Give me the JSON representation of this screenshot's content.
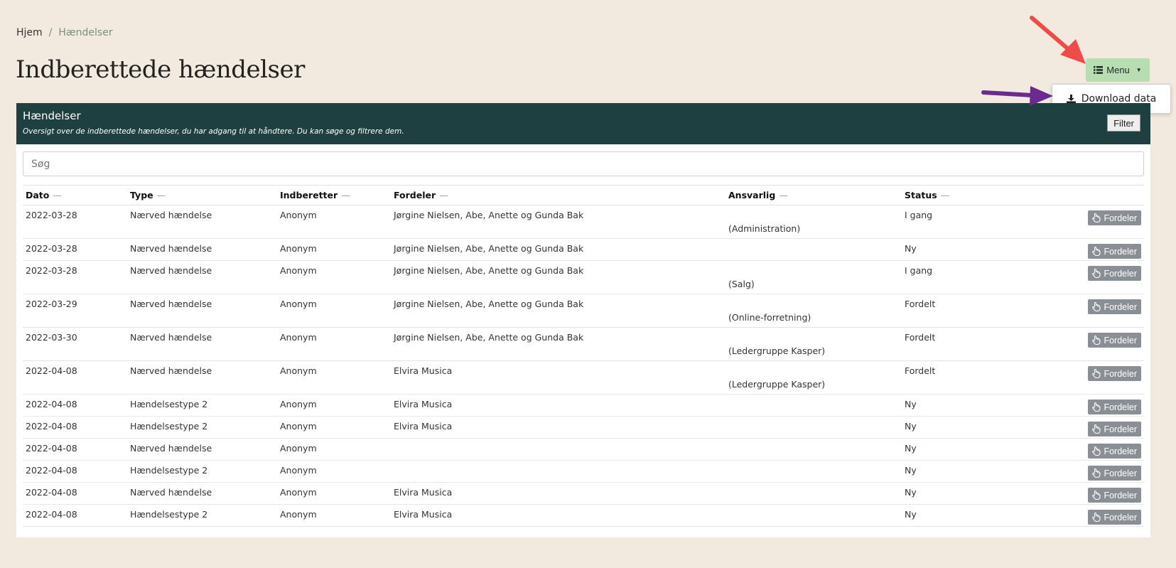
{
  "breadcrumb": {
    "home": "Hjem",
    "separator": "/",
    "current": "Hændelser"
  },
  "page_title": "Indberettede hændelser",
  "menu": {
    "label": "Menu",
    "icon": "list-icon",
    "dropdown_item": "Download data",
    "dropdown_icon": "download-icon"
  },
  "panel": {
    "title": "Hændelser",
    "description": "Oversigt over de indberettede hændelser, du har adgang til at håndtere. Du kan søge og filtrere dem.",
    "filter_label": "Filter"
  },
  "search": {
    "placeholder": "Søg"
  },
  "table": {
    "headers": [
      "Dato",
      "Type",
      "Indberetter",
      "Fordeler",
      "Ansvarlig",
      "Status"
    ],
    "sort_glyph": "—",
    "action_label": "Fordeler",
    "rows": [
      {
        "dato": "2022-03-28",
        "type": "Nærved hændelse",
        "indberetter": "Anonym",
        "fordeler": "Jørgine Nielsen, Abe, Anette og Gunda Bak",
        "ansvarlig": "(Administration)",
        "status": "I gang"
      },
      {
        "dato": "2022-03-28",
        "type": "Nærved hændelse",
        "indberetter": "Anonym",
        "fordeler": "Jørgine Nielsen, Abe, Anette og Gunda Bak",
        "ansvarlig": "",
        "status": "Ny"
      },
      {
        "dato": "2022-03-28",
        "type": "Nærved hændelse",
        "indberetter": "Anonym",
        "fordeler": "Jørgine Nielsen, Abe, Anette og Gunda Bak",
        "ansvarlig": "(Salg)",
        "status": "I gang"
      },
      {
        "dato": "2022-03-29",
        "type": "Nærved hændelse",
        "indberetter": "Anonym",
        "fordeler": "Jørgine Nielsen, Abe, Anette og Gunda Bak",
        "ansvarlig": "(Online-forretning)",
        "status": "Fordelt"
      },
      {
        "dato": "2022-03-30",
        "type": "Nærved hændelse",
        "indberetter": "Anonym",
        "fordeler": "Jørgine Nielsen, Abe, Anette og Gunda Bak",
        "ansvarlig": "(Ledergruppe Kasper)",
        "status": "Fordelt"
      },
      {
        "dato": "2022-04-08",
        "type": "Nærved hændelse",
        "indberetter": "Anonym",
        "fordeler": "Elvira Musica",
        "ansvarlig": "(Ledergruppe Kasper)",
        "status": "Fordelt"
      },
      {
        "dato": "2022-04-08",
        "type": "Hændelsestype 2",
        "indberetter": "Anonym",
        "fordeler": "Elvira Musica",
        "ansvarlig": "",
        "status": "Ny"
      },
      {
        "dato": "2022-04-08",
        "type": "Hændelsestype 2",
        "indberetter": "Anonym",
        "fordeler": "Elvira Musica",
        "ansvarlig": "",
        "status": "Ny"
      },
      {
        "dato": "2022-04-08",
        "type": "Nærved hændelse",
        "indberetter": "Anonym",
        "fordeler": "",
        "ansvarlig": "",
        "status": "Ny"
      },
      {
        "dato": "2022-04-08",
        "type": "Hændelsestype 2",
        "indberetter": "Anonym",
        "fordeler": "",
        "ansvarlig": "",
        "status": "Ny"
      },
      {
        "dato": "2022-04-08",
        "type": "Nærved hændelse",
        "indberetter": "Anonym",
        "fordeler": "Elvira Musica",
        "ansvarlig": "",
        "status": "Ny"
      },
      {
        "dato": "2022-04-08",
        "type": "Hændelsestype 2",
        "indberetter": "Anonym",
        "fordeler": "Elvira Musica",
        "ansvarlig": "",
        "status": "Ny"
      }
    ]
  },
  "colors": {
    "page_bg": "#f3eadf",
    "panel_header_bg": "#1f4040",
    "menu_button_bg": "#b8ddb3",
    "action_button_bg": "#8a8f95",
    "annotation_red": "#ef4b4b",
    "annotation_purple": "#6a2a90"
  }
}
